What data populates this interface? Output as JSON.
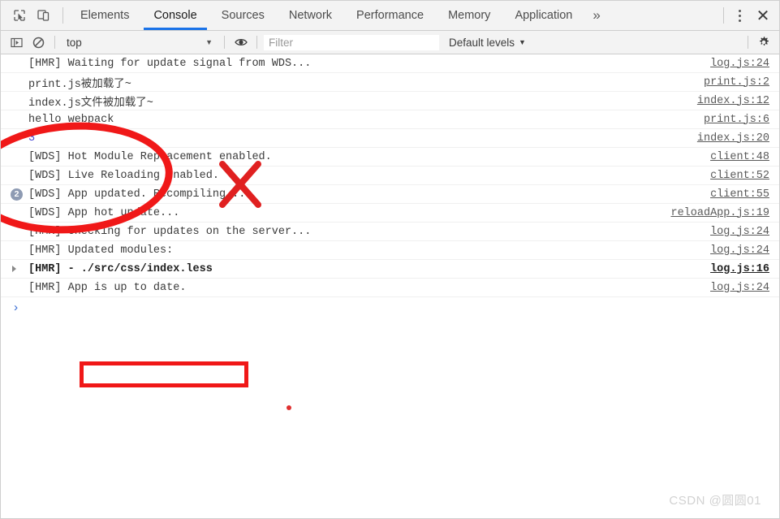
{
  "toolbar": {
    "inspect_icon": "inspect-cursor-icon",
    "device_icon": "device-toolbar-icon",
    "tabs": [
      {
        "label": "Elements",
        "active": false
      },
      {
        "label": "Console",
        "active": true
      },
      {
        "label": "Sources",
        "active": false
      },
      {
        "label": "Network",
        "active": false
      },
      {
        "label": "Performance",
        "active": false
      },
      {
        "label": "Memory",
        "active": false
      },
      {
        "label": "Application",
        "active": false
      }
    ],
    "more_tabs_label": "»",
    "menu_icon": "kebab-menu-icon",
    "close_label": "✕",
    "accent_color": "#1a73e8"
  },
  "filterbar": {
    "sidebar_toggle_icon": "console-sidebar-icon",
    "clear_icon": "clear-console-icon",
    "context": "top",
    "context_caret": "▼",
    "eye_icon": "live-expression-icon",
    "filter_placeholder": "Filter",
    "filter_value": "",
    "levels_label": "Default levels",
    "levels_caret": "▼",
    "settings_icon": "gear-icon"
  },
  "console": {
    "rows": [
      {
        "badge": "",
        "triangle": false,
        "message": "[HMR] Waiting for update signal from WDS...",
        "style": "normal",
        "source": "log.js:24",
        "source_bold": false
      },
      {
        "badge": "",
        "triangle": false,
        "message": "print.js被加载了~",
        "style": "normal",
        "source": "print.js:2",
        "source_bold": false
      },
      {
        "badge": "",
        "triangle": false,
        "message": "index.js文件被加载了~",
        "style": "normal",
        "source": "index.js:12",
        "source_bold": false
      },
      {
        "badge": "",
        "triangle": false,
        "message": "hello webpack",
        "style": "normal",
        "source": "print.js:6",
        "source_bold": false
      },
      {
        "badge": "",
        "triangle": false,
        "message": "3",
        "style": "number",
        "source": "index.js:20",
        "source_bold": false
      },
      {
        "badge": "",
        "triangle": false,
        "message": "[WDS] Hot Module Replacement enabled.",
        "style": "normal",
        "source": "client:48",
        "source_bold": false
      },
      {
        "badge": "",
        "triangle": false,
        "message": "[WDS] Live Reloading enabled.",
        "style": "normal",
        "source": "client:52",
        "source_bold": false
      },
      {
        "badge": "2",
        "triangle": false,
        "message": "[WDS] App updated. Recompiling...",
        "style": "normal",
        "source": "client:55",
        "source_bold": false
      },
      {
        "badge": "",
        "triangle": false,
        "message": "[WDS] App hot update...",
        "style": "normal",
        "source": "reloadApp.js:19",
        "source_bold": false
      },
      {
        "badge": "",
        "triangle": false,
        "message": "[HMR] Checking for updates on the server...",
        "style": "normal",
        "source": "log.js:24",
        "source_bold": false
      },
      {
        "badge": "",
        "triangle": false,
        "message": "[HMR] Updated modules:",
        "style": "normal",
        "source": "log.js:24",
        "source_bold": false
      },
      {
        "badge": "",
        "triangle": true,
        "message": "[HMR]    - ./src/css/index.less",
        "style": "bold",
        "source": "log.js:16",
        "source_bold": true
      },
      {
        "badge": "",
        "triangle": false,
        "message": "[HMR] App is up to date.",
        "style": "normal",
        "source": "log.js:24",
        "source_bold": false
      }
    ],
    "prompt_symbol": "›"
  },
  "annotations": {
    "circle_color": "#f01818",
    "x_color": "#e02020",
    "rect_color": "#f01818",
    "dot_color": "#e03030"
  },
  "watermark": "CSDN @圆圆01"
}
